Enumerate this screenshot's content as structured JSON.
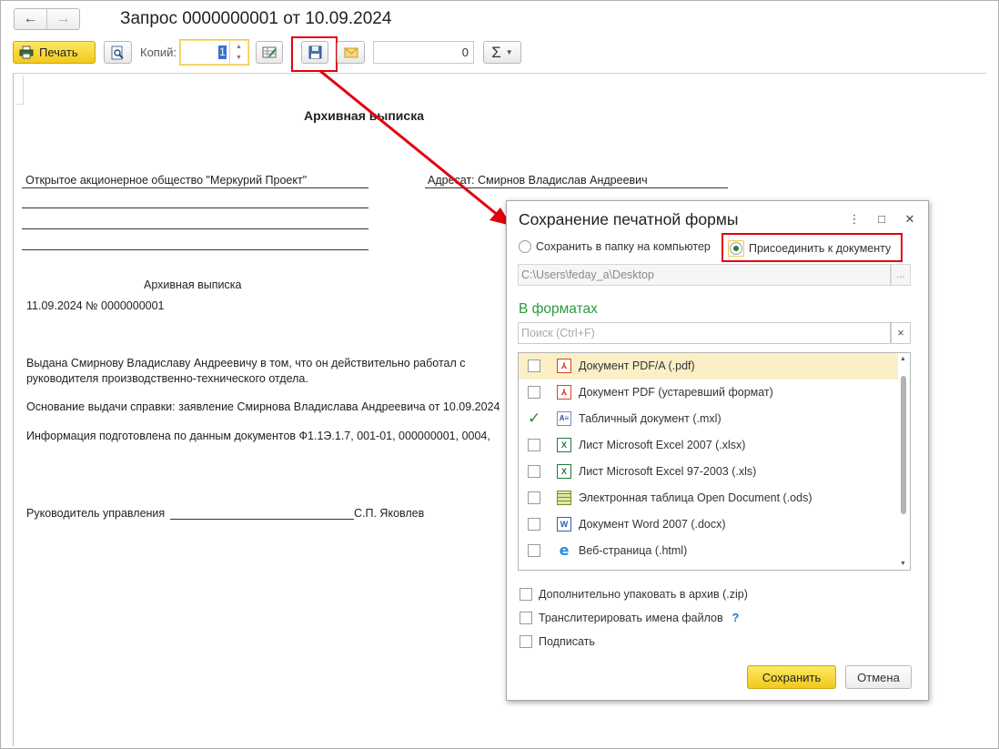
{
  "window": {
    "title": "Запрос 0000000001 от 10.09.2024",
    "back_icon": "←",
    "forward_icon": "→"
  },
  "toolbar": {
    "print_label": "Печать",
    "copies_label": "Копий:",
    "copies_value": "1",
    "sum_value": "0",
    "sum_symbol": "Σ",
    "dropdown_caret": "▼"
  },
  "document": {
    "heading": "Архивная выписка",
    "organization": "Открытое акционерное общество \"Меркурий Проект\"",
    "addressee": "Адресат: Смирнов Владислав Андреевич",
    "subheading": "Архивная выписка",
    "date_number": "11.09.2024 № 0000000001",
    "paragraph1": "Выдана Смирнову Владиславу Андреевичу в том, что он действительно работал с руководителя производственно-технического отдела.",
    "paragraph2": "Основание выдачи справки: заявление Смирнова Владислава Андреевича от 10.09.2024",
    "paragraph3": "Информация подготовлена по данным документов Ф1.1Э.1.7, 001-01, 000000001, 0004,",
    "signer_title": "Руководитель управления",
    "signer_name": "С.П. Яковлев"
  },
  "dialog": {
    "title": "Сохранение печатной формы",
    "menu_icon": "⋮",
    "maximize_icon": "□",
    "close_icon": "✕",
    "radio_folder_label": "Сохранить в папку на компьютер",
    "radio_attach_label": "Присоединить к документу",
    "selected_option": "attach",
    "path_value": "C:\\Users\\feday_a\\Desktop",
    "path_button": "...",
    "formats_title": "В форматах",
    "search_placeholder": "Поиск (Ctrl+F)",
    "search_clear": "×",
    "formats": [
      {
        "label": "Документ PDF/A (.pdf)",
        "checked": false,
        "icon": "pdf-icon"
      },
      {
        "label": "Документ PDF (устаревший формат)",
        "checked": false,
        "icon": "pdf-icon"
      },
      {
        "label": "Табличный документ (.mxl)",
        "checked": true,
        "icon": "mxl-icon"
      },
      {
        "label": "Лист Microsoft Excel 2007 (.xlsx)",
        "checked": false,
        "icon": "excel-icon"
      },
      {
        "label": "Лист Microsoft Excel 97-2003 (.xls)",
        "checked": false,
        "icon": "excel-icon"
      },
      {
        "label": "Электронная таблица Open Document (.ods)",
        "checked": false,
        "icon": "ods-icon"
      },
      {
        "label": "Документ Word 2007 (.docx)",
        "checked": false,
        "icon": "word-icon"
      },
      {
        "label": "Веб-страница (.html)",
        "checked": false,
        "icon": "html-icon"
      }
    ],
    "option_zip": "Дополнительно упаковать в архив (.zip)",
    "option_translit": "Транслитерировать имена файлов",
    "help_mark": "?",
    "option_sign": "Подписать",
    "save_button": "Сохранить",
    "cancel_button": "Отмена"
  },
  "colors": {
    "accent_yellow": "#f2c91c",
    "highlight_red": "#e3000f",
    "section_green": "#2e9a3d",
    "selected_row": "#fbefc7"
  }
}
